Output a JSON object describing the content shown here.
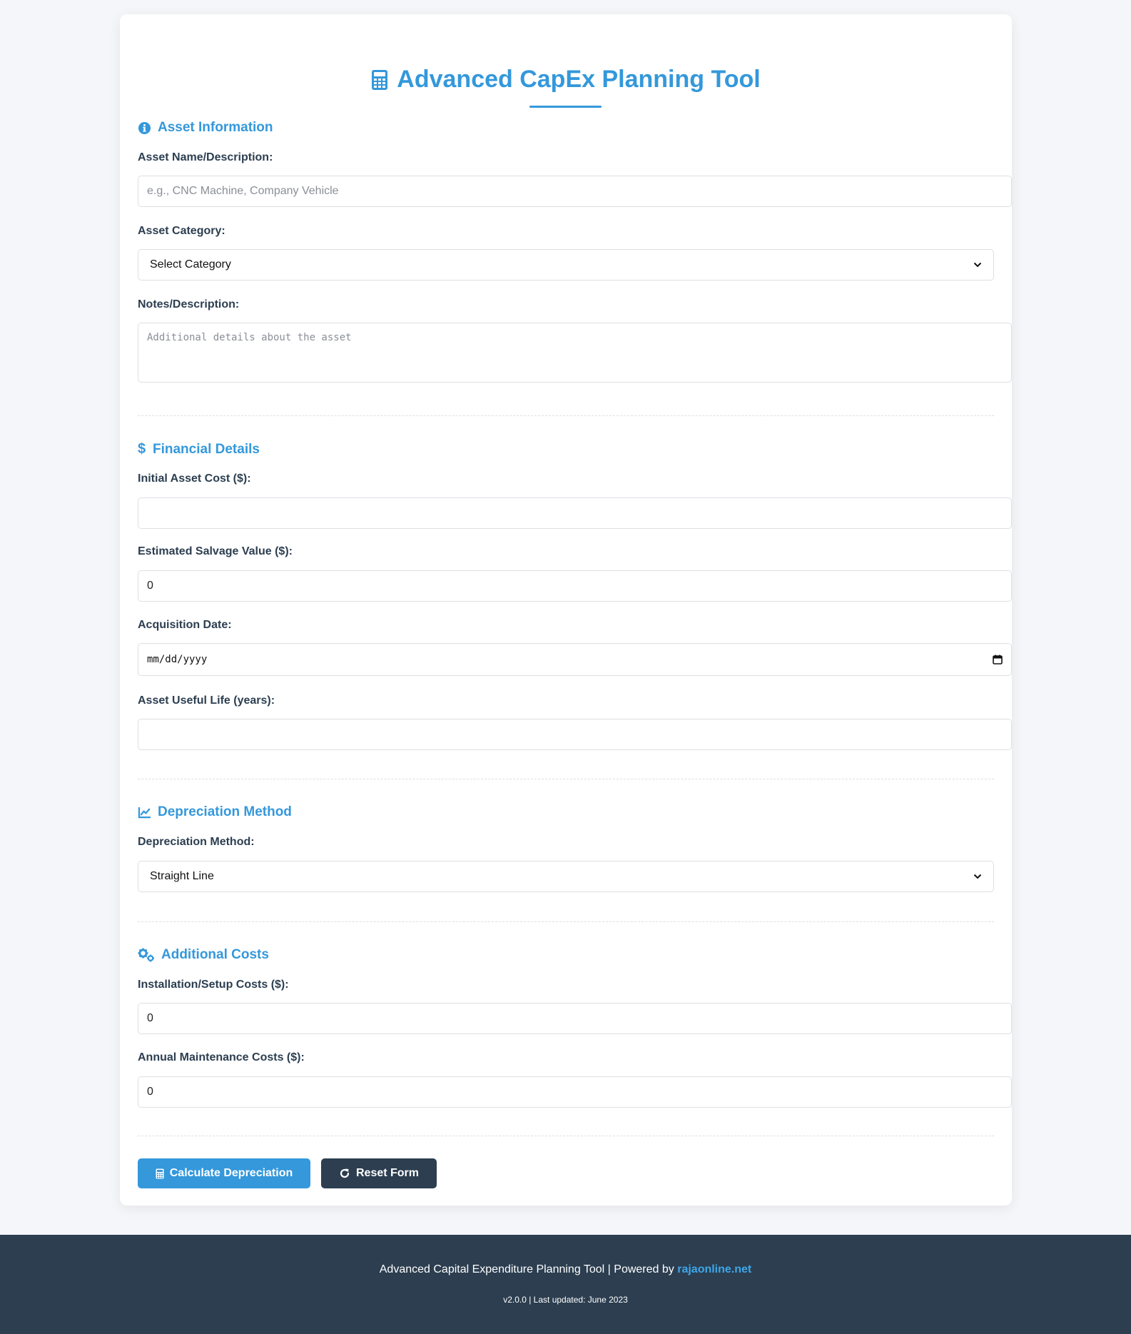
{
  "header": {
    "title": "Advanced CapEx Planning Tool",
    "title_icon": "calculator-icon"
  },
  "sections": {
    "asset_info": {
      "title": "Asset Information",
      "icon": "info-circle-icon",
      "asset_name_label": "Asset Name/Description:",
      "asset_name_placeholder": "e.g., CNC Machine, Company Vehicle",
      "category_label": "Asset Category:",
      "category_value": "Select Category",
      "notes_label": "Notes/Description:",
      "notes_placeholder": "Additional details about the asset"
    },
    "financial": {
      "title": "Financial Details",
      "icon": "dollar-icon",
      "initial_cost_label": "Initial Asset Cost ($):",
      "initial_cost_value": "",
      "salvage_label": "Estimated Salvage Value ($):",
      "salvage_value": "0",
      "acq_date_label": "Acquisition Date:",
      "acq_date_value": "mm/dd/yyyy",
      "useful_life_label": "Asset Useful Life (years):",
      "useful_life_value": ""
    },
    "depreciation": {
      "title": "Depreciation Method",
      "icon": "chart-line-icon",
      "method_label": "Depreciation Method:",
      "method_value": "Straight Line"
    },
    "additional": {
      "title": "Additional Costs",
      "icon": "cogs-icon",
      "install_label": "Installation/Setup Costs ($):",
      "install_value": "0",
      "maintenance_label": "Annual Maintenance Costs ($):",
      "maintenance_value": "0"
    }
  },
  "buttons": {
    "calculate_label": "Calculate Depreciation",
    "reset_label": "Reset Form"
  },
  "footer": {
    "line1_prefix": "Advanced Capital Expenditure Planning Tool | Powered by ",
    "link_text": "rajaonline.net",
    "line2": "v2.0.0 | Last updated: June 2023"
  },
  "colors": {
    "accent": "#3498db",
    "dark": "#2c3e50",
    "background": "#f4f6f9"
  }
}
